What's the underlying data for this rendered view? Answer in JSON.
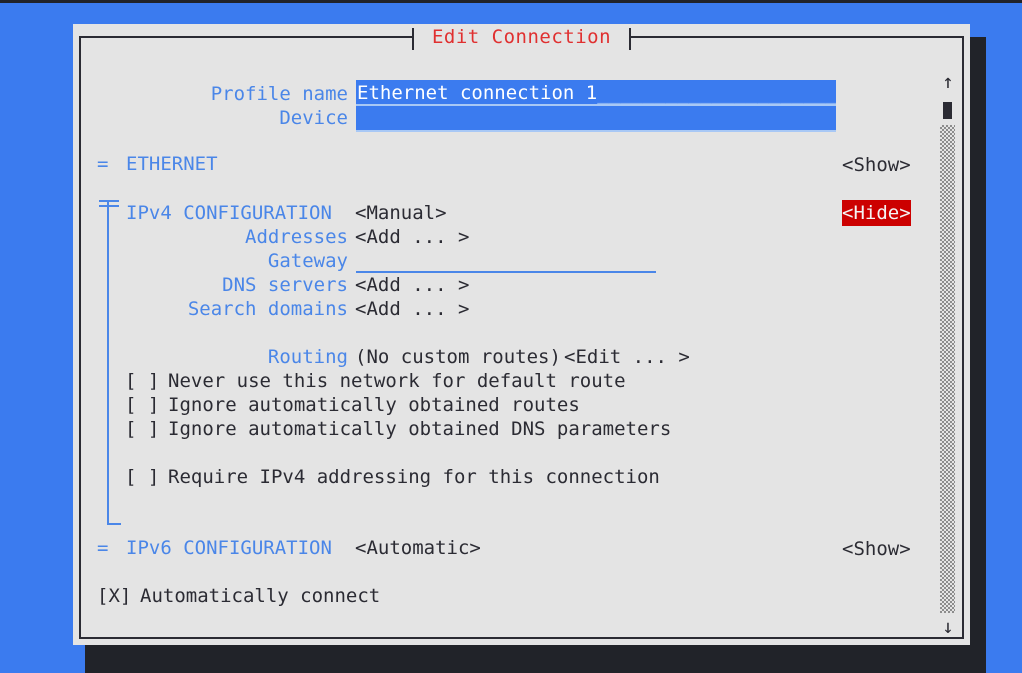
{
  "window": {
    "title": "Edit Connection"
  },
  "form": {
    "profile_name": {
      "label": "Profile name",
      "value": "Ethernet connection 1",
      "filler": "_____________________"
    },
    "device": {
      "label": "Device",
      "value": ""
    }
  },
  "sections": {
    "ethernet": {
      "marker": "=",
      "label": "ETHERNET",
      "toggle": "<Show>"
    },
    "ipv4": {
      "marker": "=",
      "label": "IPv4 CONFIGURATION",
      "mode": "<Manual>",
      "toggle": "<Hide>",
      "toggle_focused": true,
      "fields": [
        {
          "label": "Addresses",
          "value": "<Add ... >",
          "type": "button"
        },
        {
          "label": "Gateway",
          "value": "",
          "type": "input"
        },
        {
          "label": "DNS servers",
          "value": "<Add ... >",
          "type": "button"
        },
        {
          "label": "Search domains",
          "value": "<Add ... >",
          "type": "button"
        }
      ],
      "routing": {
        "label": "Routing",
        "summary": "(No custom routes)",
        "edit_button": "<Edit ... >"
      },
      "checkboxes": [
        {
          "checked": false,
          "mark": "[ ]",
          "label": "Never use this network for default route"
        },
        {
          "checked": false,
          "mark": "[ ]",
          "label": "Ignore automatically obtained routes"
        },
        {
          "checked": false,
          "mark": "[ ]",
          "label": "Ignore automatically obtained DNS parameters"
        }
      ],
      "require_checkbox": {
        "checked": false,
        "mark": "[ ]",
        "label": "Require IPv4 addressing for this connection"
      }
    },
    "ipv6": {
      "marker": "=",
      "label": "IPv6 CONFIGURATION",
      "mode": "<Automatic>",
      "toggle": "<Show>"
    }
  },
  "bottom": {
    "auto_connect": {
      "checked": true,
      "mark": "[X]",
      "label": "Automatically connect"
    }
  },
  "scrollbar": {
    "up_arrow": "↑",
    "down_arrow": "↓"
  },
  "colors": {
    "desktop_blue": "#3b7bef",
    "window_bg": "#e4e4e4",
    "label_blue": "#4a86e8",
    "title_red": "#e03030",
    "focus_red": "#cc0000",
    "text_dark": "#2b2b33",
    "shadow": "#212329"
  }
}
